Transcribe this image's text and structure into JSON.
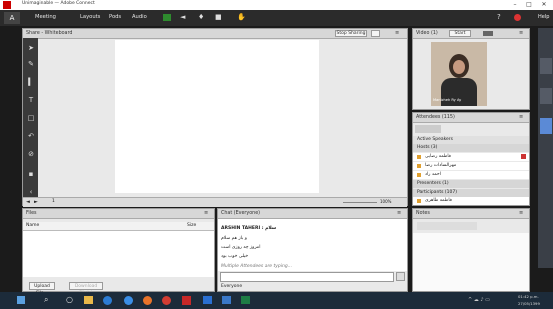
{
  "window": {
    "title": "Unimaginable — Adobe Connect"
  },
  "menu": {
    "items": [
      "Meeting",
      "Layouts",
      "Pods",
      "Audio"
    ]
  },
  "share_pod": {
    "title": "Share - Whiteboard",
    "stop_sharing": "Stop Sharing",
    "page": "1",
    "zoom": "100%"
  },
  "video_pod": {
    "title": "Video (1)",
    "start_label": "Start",
    "name_tag": "Manizheh Ry Ay"
  },
  "attendees": {
    "title": "Attendees (115)",
    "active_speakers": "Active Speakers",
    "hosts_label": "Hosts (3)",
    "hosts": [
      "فاطمه رضایی",
      "مهرالسادات رضا",
      "احمد راد"
    ],
    "presenters_label": "Presenters (1)",
    "participants_label": "Participants (107)",
    "participant": "فاطمه طاهری"
  },
  "files_pod": {
    "title": "Files",
    "col_name": "Name",
    "col_size": "Size",
    "upload": "Upload File...",
    "download": "Download File(s)"
  },
  "chat_pod": {
    "title": "Chat (Everyone)",
    "header": "ARSHIN TAHERI : سلام",
    "messages": [
      "و باز هم سلام",
      "امروز چه روزی است",
      "خیلی خوب بود"
    ],
    "typing": "Multiple Attendees are typing...",
    "tab": "Everyone"
  },
  "notes_pod": {
    "title": "Notes"
  },
  "taskbar": {
    "time": "01:42 p.m.",
    "date": "27/05/1399"
  },
  "colors": {
    "menubar": "#2b2b2b",
    "pod_bg": "#e9e9e9",
    "taskbar": "#1c2b3a"
  }
}
